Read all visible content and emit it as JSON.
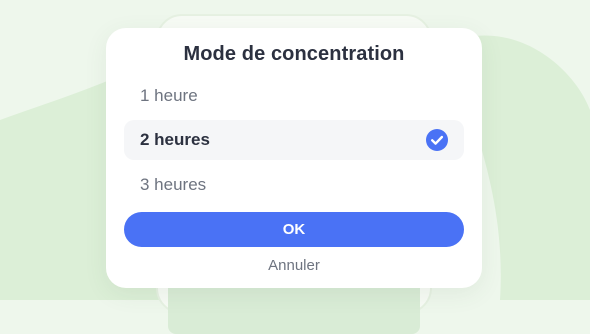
{
  "dialog": {
    "title": "Mode de concentration",
    "options": [
      {
        "label": "1 heure",
        "selected": false
      },
      {
        "label": "2 heures",
        "selected": true
      },
      {
        "label": "3 heures",
        "selected": false
      }
    ],
    "ok_label": "OK",
    "cancel_label": "Annuler"
  },
  "icons": {
    "selected_marker": "check-circle-icon"
  },
  "colors": {
    "accent": "#4a72f5",
    "background": "#eef7ec",
    "background_shape": "#dcefd7",
    "dialog": "#ffffff",
    "selected_row": "#f5f6f8",
    "title_text": "#2c3140",
    "secondary_text": "#6e7480"
  }
}
